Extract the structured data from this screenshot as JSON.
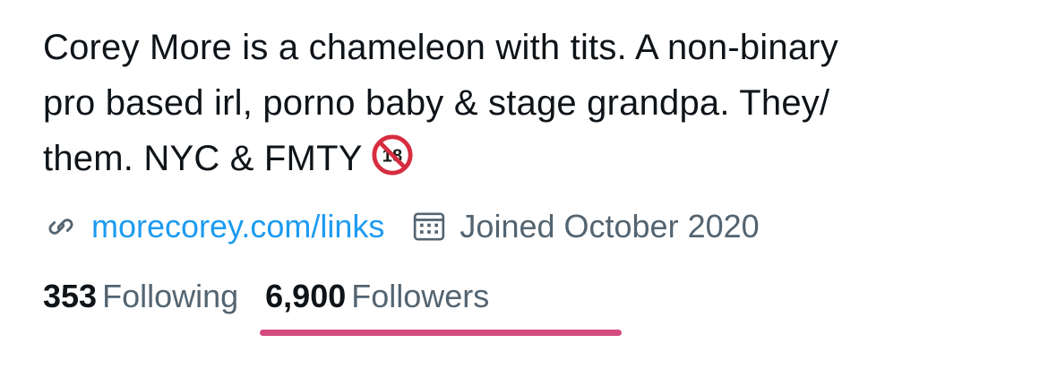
{
  "profile": {
    "bio_lines": [
      "Corey More is a chameleon with tits. A non-binary",
      "pro based irl, porno baby & stage grandpa. They/",
      "them. NYC & FMTY"
    ],
    "bio_emoji": "no-one-under-eighteen-emoji"
  },
  "meta": {
    "link_icon": "link-icon",
    "link_text": "morecorey.com/links",
    "calendar_icon": "calendar-icon",
    "joined_text": "Joined October 2020"
  },
  "stats": {
    "following_count": "353",
    "following_label": "Following",
    "followers_count": "6,900",
    "followers_label": "Followers"
  },
  "colors": {
    "link": "#1d9bf0",
    "secondary_text": "#536471",
    "primary_text": "#0f1419",
    "highlight_underline": "#d44a7f",
    "emoji_red": "#d62d3f"
  }
}
